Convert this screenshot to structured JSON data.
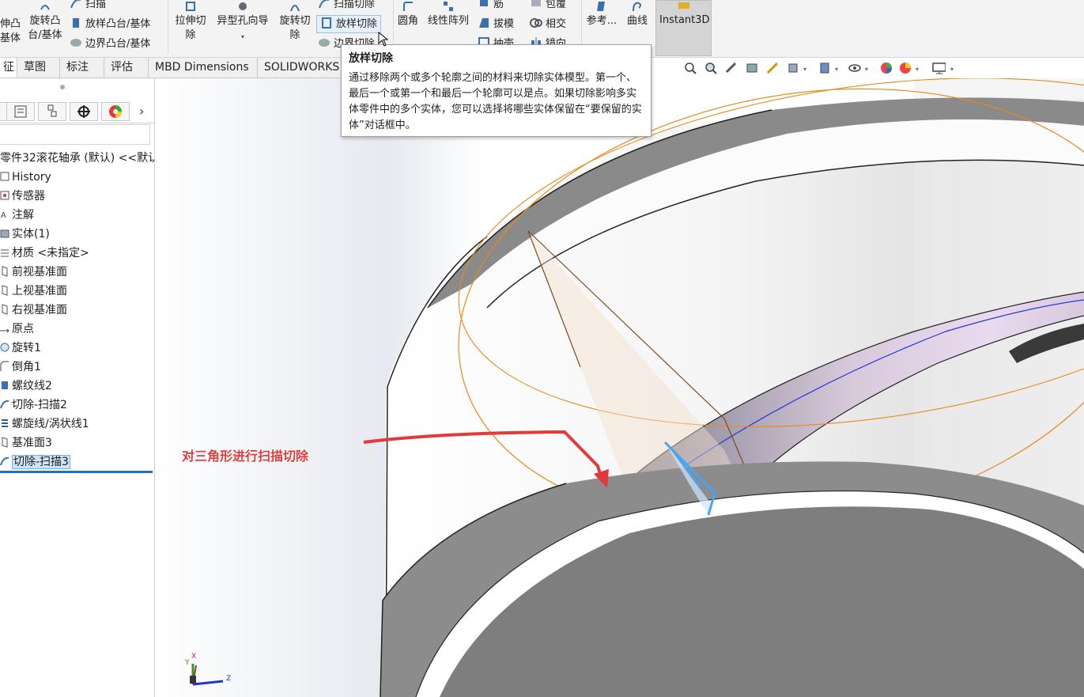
{
  "ribbon": {
    "extrude_boss": "伸凸\n基体",
    "revolve_boss": "旋转凸\n台/基体",
    "sweep": "扫描",
    "loft_boss": "放样凸台/基体",
    "boundary_boss": "边界凸台/基体",
    "extrude_cut": "拉伸切\n除",
    "hole_wizard": "异型孔向导",
    "revolve_cut": "旋转切\n除",
    "sweep_cut": "扫描切除",
    "loft_cut": "放样切除",
    "boundary_cut": "边界切除",
    "fillet": "圆角",
    "linear_pattern": "线性阵列",
    "rib": "筋",
    "draft": "拔模",
    "shell": "抽壳",
    "wrap": "包覆",
    "intersect": "相交",
    "mirror": "镜向",
    "reference": "参考...",
    "curves": "曲线",
    "instant3d": "Instant3D"
  },
  "tabs": [
    "征",
    "草图",
    "标注",
    "评估",
    "MBD Dimensions",
    "SOLIDWORKS"
  ],
  "tooltip": {
    "title": "放样切除",
    "body": "通过移除两个或多个轮廓之间的材料来切除实体模型。第一个、最后一个或第一个和最后一个轮廓可以是点。如果切除影响多实体零件中的多个实体，您可以选择将哪些实体保留在“要保留的实体”对话框中。"
  },
  "tree": {
    "root": "零件32滚花轴承 (默认) <<默认",
    "items": [
      {
        "label": "History",
        "icon": "history-icon"
      },
      {
        "label": "传感器",
        "icon": "sensor-icon"
      },
      {
        "label": "注解",
        "icon": "annotation-icon"
      },
      {
        "label": "实体(1)",
        "icon": "solid-bodies-icon"
      },
      {
        "label": "材质 <未指定>",
        "icon": "material-icon"
      },
      {
        "label": "前视基准面",
        "icon": "plane-icon"
      },
      {
        "label": "上视基准面",
        "icon": "plane-icon"
      },
      {
        "label": "右视基准面",
        "icon": "plane-icon"
      },
      {
        "label": "原点",
        "icon": "origin-icon"
      },
      {
        "label": "旋转1",
        "icon": "revolve-icon"
      },
      {
        "label": "倒角1",
        "icon": "chamfer-icon"
      },
      {
        "label": "螺纹线2",
        "icon": "thread-icon"
      },
      {
        "label": "切除-扫描2",
        "icon": "sweep-cut-icon"
      },
      {
        "label": "螺旋线/涡状线1",
        "icon": "helix-icon"
      },
      {
        "label": "基准面3",
        "icon": "plane-icon"
      },
      {
        "label": "切除-扫描3",
        "icon": "sweep-cut-icon",
        "selected": true
      }
    ]
  },
  "annotation": {
    "text": "对三角形进行扫描切除",
    "color": "#e23a3a"
  },
  "triad": {
    "x": "X",
    "y": "Y",
    "z": "Z"
  },
  "colors": {
    "accent": "#1f6fc5",
    "highlight": "#cce4f7",
    "arrow": "#e23a3a",
    "sketch_orange": "#e8891a",
    "helix_blue": "#2233dd"
  }
}
